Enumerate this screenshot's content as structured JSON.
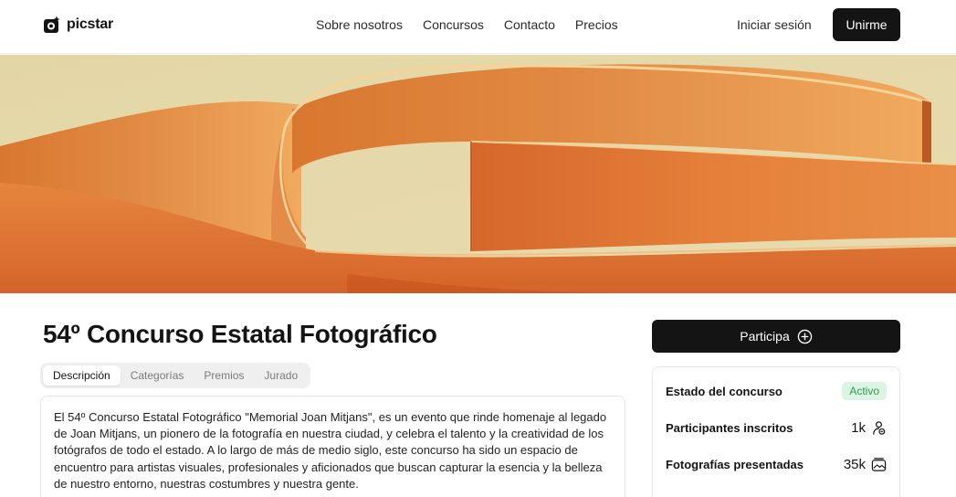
{
  "header": {
    "brand": "picstar",
    "nav": [
      "Sobre nosotros",
      "Concursos",
      "Contacto",
      "Precios"
    ],
    "login": "Iniciar sesión",
    "join": "Unirme"
  },
  "contest": {
    "title": "54º Concurso Estatal Fotográfico",
    "tabs": [
      "Descripción",
      "Categorías",
      "Premios",
      "Jurado"
    ],
    "active_tab": "Descripción",
    "description": "El 54º Concurso Estatal Fotográfico \"Memorial Joan Mitjans\", es un evento que rinde homenaje al legado de Joan Mitjans, un pionero de la fotografía en nuestra ciudad, y celebra el talento y la creatividad de los fotógrafos de todo el estado.  A lo largo de más de medio siglo, este concurso ha sido un espacio de encuentro para artistas visuales, profesionales y aficionados que buscan capturar la esencia y la belleza de nuestro entorno, nuestras costumbres y nuestra gente."
  },
  "sidebar": {
    "cta": "Participa",
    "status_label": "Estado del concurso",
    "status_value": "Activo",
    "participants_label": "Participantes inscritos",
    "participants_value": "1k",
    "photos_label": "Fotografías presentadas",
    "photos_value": "35k"
  },
  "icons": {
    "logo": "camera-logo-icon",
    "cta": "plus-circle-icon",
    "participants": "users-icon",
    "photos": "photos-icon"
  },
  "colors": {
    "primary": "#141414",
    "hero_orange": "#e0833f",
    "hero_cream": "#e2d6a8",
    "active_badge_bg": "#dcf5e3",
    "active_badge_text": "#2f9a55"
  }
}
